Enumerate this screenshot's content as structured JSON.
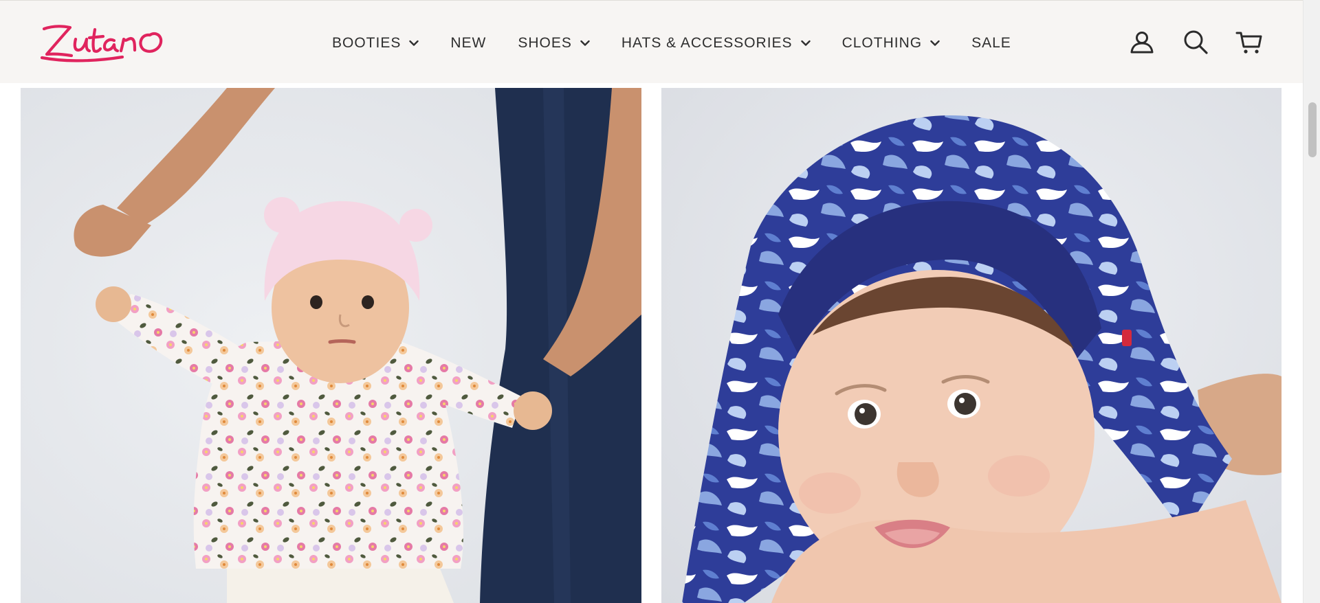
{
  "brand": {
    "logo_text": "Zutano",
    "accent_color": "#e0245e"
  },
  "nav": {
    "items": [
      {
        "label": "BOOTIES",
        "has_dropdown": true
      },
      {
        "label": "NEW",
        "has_dropdown": false
      },
      {
        "label": "SHOES",
        "has_dropdown": true
      },
      {
        "label": "HATS & ACCESSORIES",
        "has_dropdown": true
      },
      {
        "label": "CLOTHING",
        "has_dropdown": true
      },
      {
        "label": "SALE",
        "has_dropdown": false
      }
    ]
  },
  "header_icons": [
    "account-icon",
    "search-icon",
    "cart-icon"
  ],
  "gallery": {
    "images": [
      {
        "name": "baby-floral-top-pink-hat-photo"
      },
      {
        "name": "baby-blue-hooded-towel-photo"
      }
    ]
  }
}
